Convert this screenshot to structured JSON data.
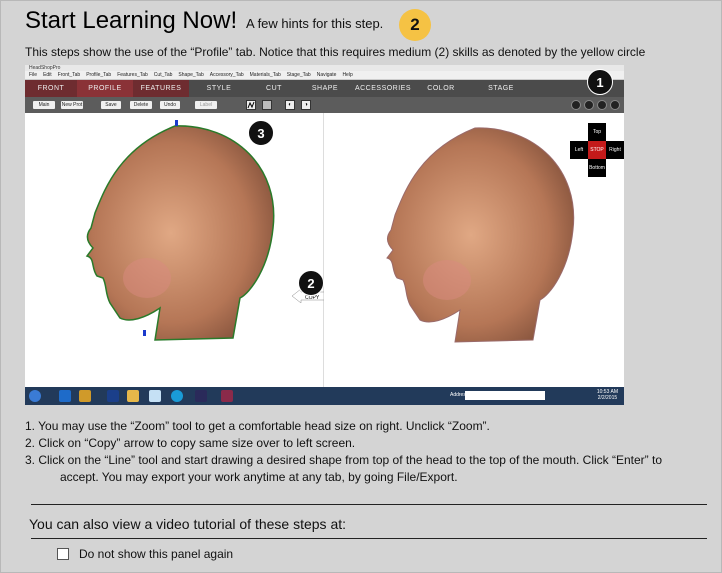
{
  "header": {
    "title": "Start Learning Now!",
    "hint": "A few hints for this step.",
    "skill_level": "2",
    "skill_color": "#f5c244"
  },
  "intro": "This steps show the use of the “Profile” tab. Notice that this requires medium (2) skills as denoted by the yellow circle",
  "screenshot": {
    "app_title": "HeadShopPro",
    "menu": [
      "File",
      "Edit",
      "Front_Tab",
      "Profile_Tab",
      "Features_Tab",
      "Cut_Tab",
      "Shape_Tab",
      "Accessory_Tab",
      "Materials_Tab",
      "Stage_Tab",
      "Navigate",
      "Help"
    ],
    "tabs": [
      "Front",
      "Profile",
      "Features",
      "Style",
      "Cut",
      "Shape",
      "Accessories",
      "Color",
      "Stage"
    ],
    "toolbar_buttons": [
      "Main",
      "New Prot",
      "Save",
      "Delete",
      "Undo",
      "Label"
    ],
    "copy_label": "COPY",
    "dpad": {
      "top": "Top",
      "left": "Left",
      "center": "STOP",
      "right": "Right",
      "bottom": "Bottom"
    },
    "markers": [
      "1",
      "2",
      "3"
    ],
    "taskbar_address_label": "Address",
    "clock_time": "10:53 AM",
    "clock_date": "2/2/2015"
  },
  "steps": {
    "s1": "1. You may use the “Zoom” tool to get a comfortable head size on right. Unclick “Zoom”.",
    "s2": "2. Click on “Copy” arrow to copy same size over to left screen.",
    "s3a": "3. Click on the “Line” tool and start drawing a desired shape from top of the head to the top of the mouth. Click “Enter” to",
    "s3b": "accept.  You may export your work anytime at any tab, by going File/Export."
  },
  "video_text": "You can also view a video tutorial of these steps at:",
  "checkbox_label": "Do not show this panel again"
}
